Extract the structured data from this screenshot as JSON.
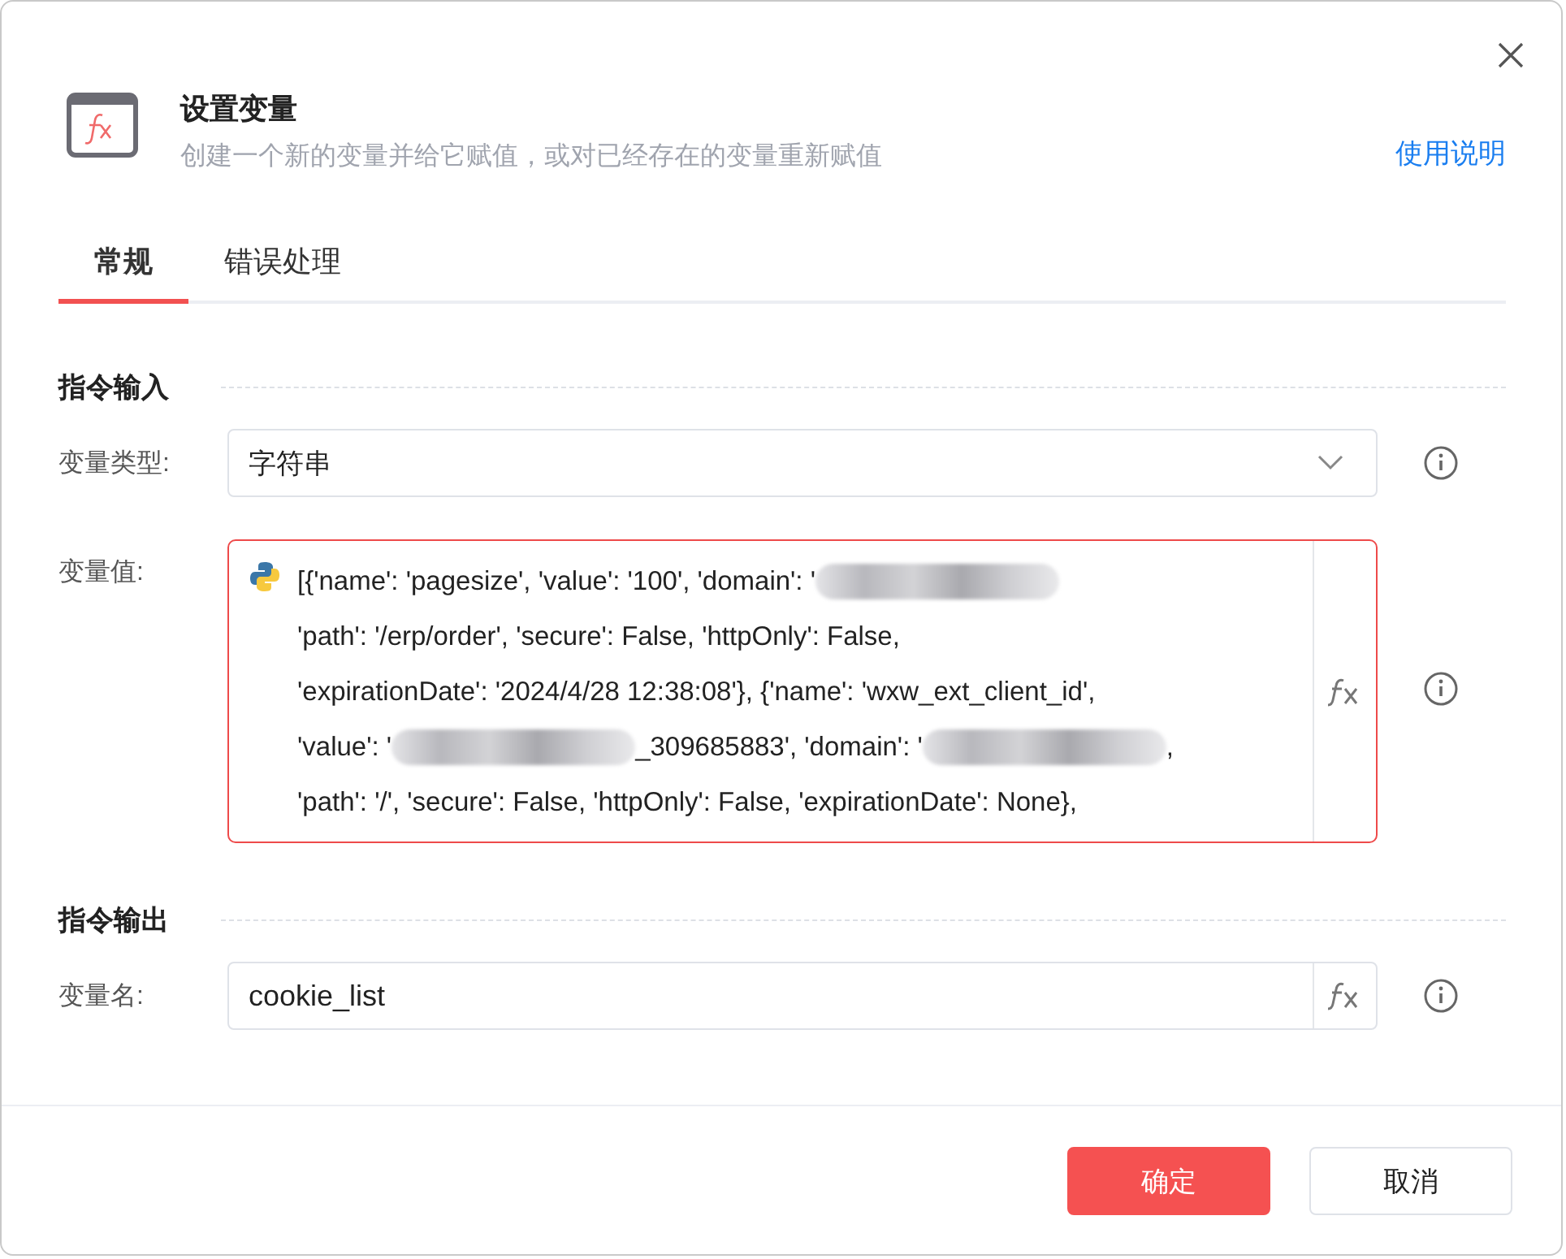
{
  "dialog": {
    "title": "设置变量",
    "subtitle": "创建一个新的变量并给它赋值，或对已经存在的变量重新赋值",
    "help_link": "使用说明"
  },
  "tabs": [
    {
      "label": "常规",
      "selected": true
    },
    {
      "label": "错误处理",
      "selected": false
    }
  ],
  "input_section": {
    "title": "指令输入",
    "type_field": {
      "label": "变量类型:",
      "value": "字符串"
    },
    "value_field": {
      "label": "变量值:",
      "error": true,
      "lines": [
        [
          {
            "kind": "text",
            "text": "[{'name': 'pagesize', 'value': '100', 'domain': '"
          },
          {
            "kind": "redacted"
          }
        ],
        [
          {
            "kind": "text",
            "text": "'path': '/erp/order', 'secure': False, 'httpOnly': False,"
          }
        ],
        [
          {
            "kind": "text",
            "text": "'expirationDate': '2024/4/28 12:38:08'}, {'name': 'wxw_ext_client_id',"
          }
        ],
        [
          {
            "kind": "text",
            "text": "'value': '"
          },
          {
            "kind": "redacted"
          },
          {
            "kind": "text",
            "text": "_309685883', 'domain': '"
          },
          {
            "kind": "redacted"
          },
          {
            "kind": "text",
            "text": ","
          }
        ],
        [
          {
            "kind": "text",
            "text": "'path': '/', 'secure': False, 'httpOnly': False, 'expirationDate': None},"
          }
        ]
      ]
    }
  },
  "output_section": {
    "title": "指令输出",
    "name_field": {
      "label": "变量名:",
      "value": "cookie_list"
    }
  },
  "buttons": [
    {
      "label": "确定",
      "kind": "primary"
    },
    {
      "label": "取消",
      "kind": "secondary"
    }
  ]
}
